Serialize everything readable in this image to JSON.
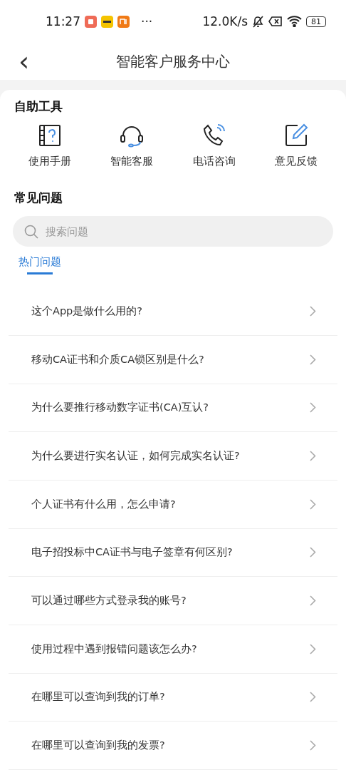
{
  "status_bar": {
    "time": "11:27",
    "more": "···",
    "speed": "12.0K/s",
    "battery": "81"
  },
  "header": {
    "back": "‹",
    "title": "智能客户服务中心"
  },
  "tools": {
    "title": "自助工具",
    "items": [
      {
        "kind": "manual",
        "label": "使用手册"
      },
      {
        "kind": "headset",
        "label": "智能客服"
      },
      {
        "kind": "phone",
        "label": "电话咨询"
      },
      {
        "kind": "feedback",
        "label": "意见反馈"
      }
    ]
  },
  "faq": {
    "title": "常见问题",
    "search": {
      "placeholder": "搜索问题"
    },
    "tabs": [
      {
        "label": "热门问题",
        "selected": true
      }
    ],
    "questions": [
      "这个App是做什么用的?",
      "移动CA证书和介质CA锁区别是什么?",
      "为什么要推行移动数字证书(CA)互认?",
      "为什么要进行实名认证，如何完成实名认证?",
      "个人证书有什么用，怎么申请?",
      "电子招投标中CA证书与电子签章有何区别?",
      "可以通过哪些方式登录我的账号?",
      "使用过程中遇到报错问题该怎么办?",
      "在哪里可以查询到我的订单?",
      "在哪里可以查询到我的发票?"
    ]
  }
}
